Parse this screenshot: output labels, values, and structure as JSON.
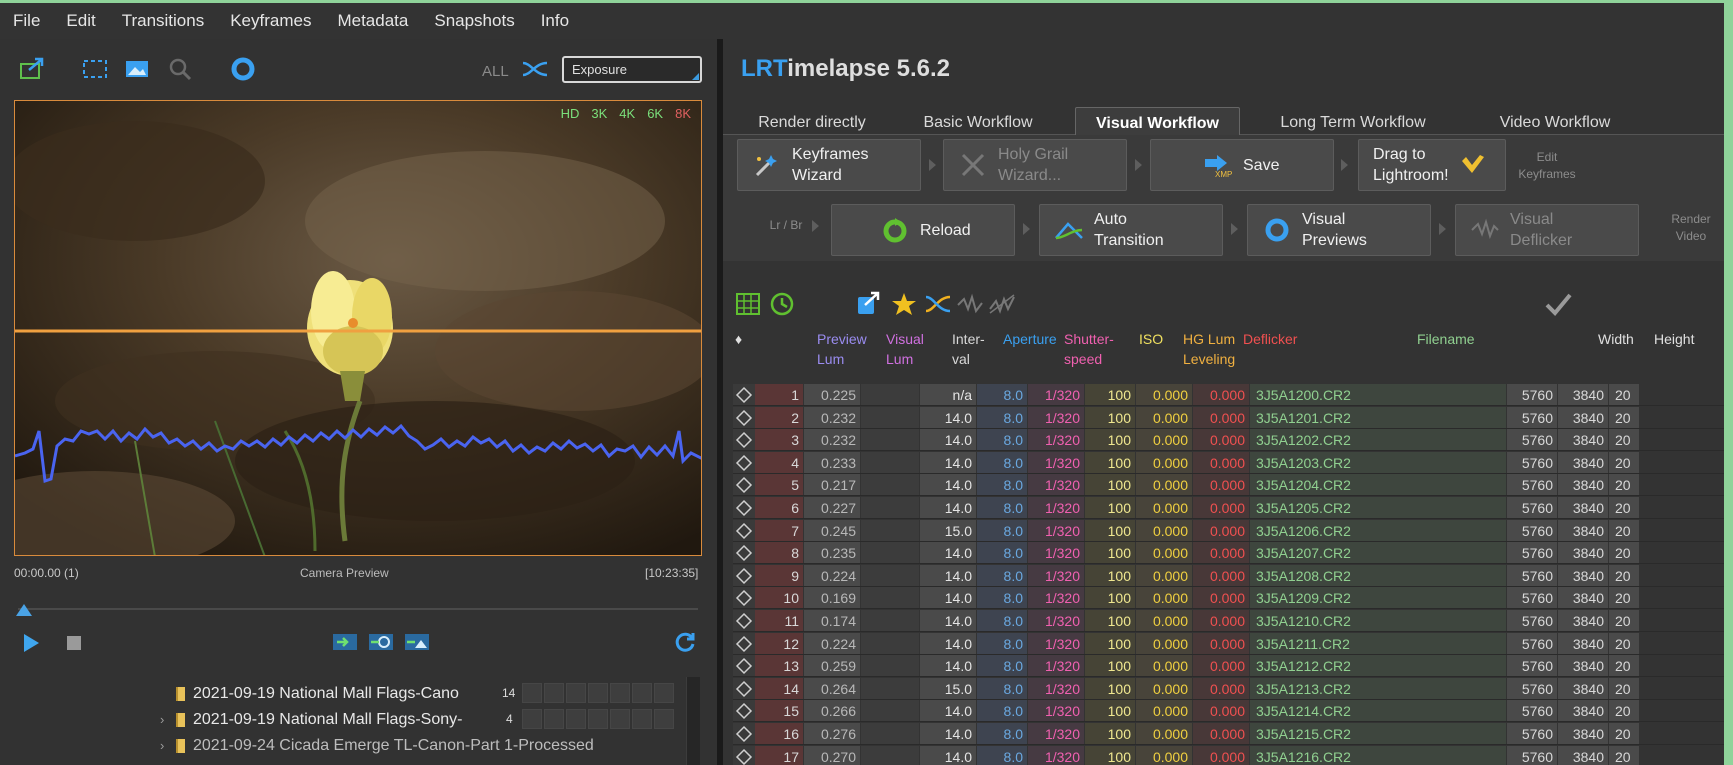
{
  "menu": [
    "File",
    "Edit",
    "Transitions",
    "Keyframes",
    "Metadata",
    "Snapshots",
    "Info"
  ],
  "left": {
    "all_label": "ALL",
    "exposure_value": "Exposure",
    "resolutions": [
      {
        "label": "HD",
        "color": "#7be07b"
      },
      {
        "label": "3K",
        "color": "#7be07b"
      },
      {
        "label": "4K",
        "color": "#7be07b"
      },
      {
        "label": "6K",
        "color": "#7be07b"
      },
      {
        "label": "8K",
        "color": "#e06060"
      }
    ],
    "preview_time": "00:00.00 (1)",
    "preview_label": "Camera Preview",
    "preview_duration": "[10:23:35]",
    "folders": [
      {
        "name": "2021-09-19 National Mall Flags-Cano",
        "count": "14"
      },
      {
        "name": "2021-09-19 National Mall Flags-Sony-",
        "count": "4"
      },
      {
        "name": "2021-09-24 Cicada Emerge TL-Canon-Part 1-Processed",
        "count": ""
      }
    ]
  },
  "right": {
    "title_accent": "LRT",
    "title_rest": "imelapse 5.6.2",
    "tabs": [
      "Render directly",
      "Basic Workflow",
      "Visual Workflow",
      "Long Term Workflow",
      "Video Workflow"
    ],
    "active_tab": "Visual Workflow",
    "workflow": {
      "keyframes_wizard": [
        "Keyframes",
        "Wizard"
      ],
      "holy_grail": [
        "Holy Grail",
        "Wizard..."
      ],
      "save": "Save",
      "drag_lr": [
        "Drag to",
        "Lightroom!"
      ],
      "edit_keyframes": [
        "Edit",
        "Keyframes"
      ],
      "lr_br": "Lr / Br",
      "reload": "Reload",
      "auto_transition": [
        "Auto",
        "Transition"
      ],
      "visual_previews": [
        "Visual",
        "Previews"
      ],
      "visual_deflicker": [
        "Visual",
        "Deflicker"
      ],
      "render_video": [
        "Render",
        "Video"
      ],
      "xmp_badge": "XMP"
    },
    "columns": [
      {
        "label": "♦",
        "label2": "",
        "color": "#e0e0e0"
      },
      {
        "label": "Preview",
        "label2": "Lum",
        "color": "#9a8cf0"
      },
      {
        "label": "Visual",
        "label2": "Lum",
        "color": "#d070e0"
      },
      {
        "label": "Inter-",
        "label2": "val",
        "color": "#d8d8d8"
      },
      {
        "label": "Aperture",
        "label2": "",
        "color": "#3aa0f0"
      },
      {
        "label": "Shutter-",
        "label2": "speed",
        "color": "#f060b0"
      },
      {
        "label": "ISO",
        "label2": "",
        "color": "#f0e060"
      },
      {
        "label": "HG Lum",
        "label2": "Leveling",
        "color": "#f0b040"
      },
      {
        "label": "Deflicker",
        "label2": "",
        "color": "#f05050"
      },
      {
        "label": "Filename",
        "label2": "",
        "color": "#90d090"
      },
      {
        "label": "Width",
        "label2": "",
        "color": "#e0e0e0"
      },
      {
        "label": "Height",
        "label2": "",
        "color": "#e0e0e0"
      }
    ],
    "rows": [
      {
        "n": "1",
        "pl": "0.225",
        "iv": "n/a",
        "ap": "8.0",
        "sh": "1/320",
        "iso": "100",
        "hg": "0.000",
        "df": "0.000",
        "fn": "3J5A1200.CR2",
        "w": "5760",
        "h": "3840",
        "x": "20"
      },
      {
        "n": "2",
        "pl": "0.232",
        "iv": "14.0",
        "ap": "8.0",
        "sh": "1/320",
        "iso": "100",
        "hg": "0.000",
        "df": "0.000",
        "fn": "3J5A1201.CR2",
        "w": "5760",
        "h": "3840",
        "x": "20"
      },
      {
        "n": "3",
        "pl": "0.232",
        "iv": "14.0",
        "ap": "8.0",
        "sh": "1/320",
        "iso": "100",
        "hg": "0.000",
        "df": "0.000",
        "fn": "3J5A1202.CR2",
        "w": "5760",
        "h": "3840",
        "x": "20"
      },
      {
        "n": "4",
        "pl": "0.233",
        "iv": "14.0",
        "ap": "8.0",
        "sh": "1/320",
        "iso": "100",
        "hg": "0.000",
        "df": "0.000",
        "fn": "3J5A1203.CR2",
        "w": "5760",
        "h": "3840",
        "x": "20"
      },
      {
        "n": "5",
        "pl": "0.217",
        "iv": "14.0",
        "ap": "8.0",
        "sh": "1/320",
        "iso": "100",
        "hg": "0.000",
        "df": "0.000",
        "fn": "3J5A1204.CR2",
        "w": "5760",
        "h": "3840",
        "x": "20"
      },
      {
        "n": "6",
        "pl": "0.227",
        "iv": "14.0",
        "ap": "8.0",
        "sh": "1/320",
        "iso": "100",
        "hg": "0.000",
        "df": "0.000",
        "fn": "3J5A1205.CR2",
        "w": "5760",
        "h": "3840",
        "x": "20"
      },
      {
        "n": "7",
        "pl": "0.245",
        "iv": "15.0",
        "ap": "8.0",
        "sh": "1/320",
        "iso": "100",
        "hg": "0.000",
        "df": "0.000",
        "fn": "3J5A1206.CR2",
        "w": "5760",
        "h": "3840",
        "x": "20"
      },
      {
        "n": "8",
        "pl": "0.235",
        "iv": "14.0",
        "ap": "8.0",
        "sh": "1/320",
        "iso": "100",
        "hg": "0.000",
        "df": "0.000",
        "fn": "3J5A1207.CR2",
        "w": "5760",
        "h": "3840",
        "x": "20"
      },
      {
        "n": "9",
        "pl": "0.224",
        "iv": "14.0",
        "ap": "8.0",
        "sh": "1/320",
        "iso": "100",
        "hg": "0.000",
        "df": "0.000",
        "fn": "3J5A1208.CR2",
        "w": "5760",
        "h": "3840",
        "x": "20"
      },
      {
        "n": "10",
        "pl": "0.169",
        "iv": "14.0",
        "ap": "8.0",
        "sh": "1/320",
        "iso": "100",
        "hg": "0.000",
        "df": "0.000",
        "fn": "3J5A1209.CR2",
        "w": "5760",
        "h": "3840",
        "x": "20"
      },
      {
        "n": "11",
        "pl": "0.174",
        "iv": "14.0",
        "ap": "8.0",
        "sh": "1/320",
        "iso": "100",
        "hg": "0.000",
        "df": "0.000",
        "fn": "3J5A1210.CR2",
        "w": "5760",
        "h": "3840",
        "x": "20"
      },
      {
        "n": "12",
        "pl": "0.224",
        "iv": "14.0",
        "ap": "8.0",
        "sh": "1/320",
        "iso": "100",
        "hg": "0.000",
        "df": "0.000",
        "fn": "3J5A1211.CR2",
        "w": "5760",
        "h": "3840",
        "x": "20"
      },
      {
        "n": "13",
        "pl": "0.259",
        "iv": "14.0",
        "ap": "8.0",
        "sh": "1/320",
        "iso": "100",
        "hg": "0.000",
        "df": "0.000",
        "fn": "3J5A1212.CR2",
        "w": "5760",
        "h": "3840",
        "x": "20"
      },
      {
        "n": "14",
        "pl": "0.264",
        "iv": "15.0",
        "ap": "8.0",
        "sh": "1/320",
        "iso": "100",
        "hg": "0.000",
        "df": "0.000",
        "fn": "3J5A1213.CR2",
        "w": "5760",
        "h": "3840",
        "x": "20"
      },
      {
        "n": "15",
        "pl": "0.266",
        "iv": "14.0",
        "ap": "8.0",
        "sh": "1/320",
        "iso": "100",
        "hg": "0.000",
        "df": "0.000",
        "fn": "3J5A1214.CR2",
        "w": "5760",
        "h": "3840",
        "x": "20"
      },
      {
        "n": "16",
        "pl": "0.276",
        "iv": "14.0",
        "ap": "8.0",
        "sh": "1/320",
        "iso": "100",
        "hg": "0.000",
        "df": "0.000",
        "fn": "3J5A1215.CR2",
        "w": "5760",
        "h": "3840",
        "x": "20"
      },
      {
        "n": "17",
        "pl": "0.270",
        "iv": "14.0",
        "ap": "8.0",
        "sh": "1/320",
        "iso": "100",
        "hg": "0.000",
        "df": "0.000",
        "fn": "3J5A1216.CR2",
        "w": "5760",
        "h": "3840",
        "x": "20"
      }
    ]
  },
  "colors": {
    "accent_blue": "#3aa0f0",
    "frame_orange": "#f0a040",
    "lum_curve": "#4a64f0"
  }
}
